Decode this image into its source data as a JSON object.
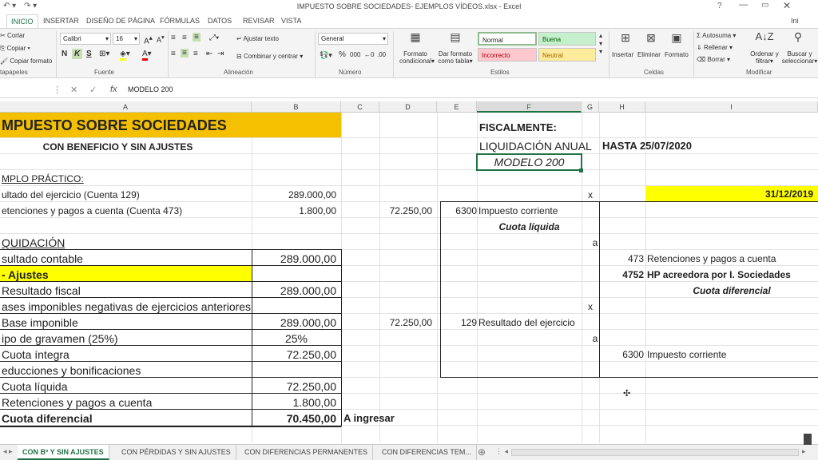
{
  "title": "IMPUESTO SOBRE SOCIEDADES- EJEMPLOS VÍDEOS.xlsx - Excel",
  "signin": "Ini",
  "help": "?",
  "tabs": [
    {
      "label": "INICIO",
      "active": true
    },
    {
      "label": "INSERTAR"
    },
    {
      "label": "DISEÑO DE PÁGINA"
    },
    {
      "label": "FÓRMULAS"
    },
    {
      "label": "DATOS"
    },
    {
      "label": "REVISAR"
    },
    {
      "label": "VISTA"
    }
  ],
  "ribbon": {
    "clipboard": {
      "cut": "Cortar",
      "copy": "Copiar",
      "copy_format": "Copiar formato",
      "label": "tapapeles"
    },
    "font": {
      "name": "Calibri",
      "size": "16",
      "bold": "N",
      "italic": "K",
      "underline": "S",
      "label": "Fuente"
    },
    "alignment": {
      "wrap": "Ajustar texto",
      "merge": "Combinar y centrar",
      "label": "Alineación"
    },
    "number": {
      "format": "General",
      "percent": "%",
      "thousands": "000",
      "label": "Número"
    },
    "styles": {
      "cond_format_1": "Formato",
      "cond_format_2": "condicional",
      "table_format_1": "Dar formato",
      "table_format_2": "como tabla",
      "normal": "Normal",
      "good": "Buena",
      "bad": "Incorrecto",
      "neutral": "Neutral",
      "label": "Estilos"
    },
    "cells": {
      "insert": "Insertar",
      "delete": "Eliminar",
      "format": "Formato",
      "label": "Celdas"
    },
    "editing": {
      "autosum": "Autosuma",
      "fill": "Rellenar",
      "clear": "Borrar",
      "sort_1": "Ordenar y",
      "sort_2": "filtrar",
      "find_1": "Buscar y",
      "find_2": "seleccionar",
      "label": "Modificar"
    }
  },
  "formula_bar": {
    "fx": "fx",
    "value": "MODELO 200"
  },
  "columns": [
    "A",
    "B",
    "C",
    "D",
    "E",
    "F",
    "G",
    "H",
    "I"
  ],
  "cells": {
    "a_title": "MPUESTO SOBRE SOCIEDADES",
    "a_sub": "CON BENEFICIO Y SIN AJUSTES",
    "a_ejemplo": "MPLO PRÁCTICO:",
    "a_r5": "ultado del ejercicio (Cuenta 129)",
    "b_r5": "289.000,00",
    "a_r6": "etenciones y pagos a cuenta (Cuenta 473)",
    "b_r6": "1.800,00",
    "d_r6": "72.250,00",
    "a_liq": "QUIDACIÓN",
    "a_r9": "sultado contable",
    "b_r9": "289.000,00",
    "a_r10": "- Ajustes",
    "a_r11": "Resultado fiscal",
    "b_r11": "289.000,00",
    "a_r12": "ases imponibles negativas de ejercicios anteriores",
    "a_r13": "Base imponible",
    "b_r13": "289.000,00",
    "d_r13": "72.250,00",
    "a_r14": "ipo de gravamen (25%)",
    "b_r14": "25%",
    "a_r15": "Cuota íntegra",
    "b_r15": "72.250,00",
    "a_r16": "educciones y bonificaciones",
    "a_r17": "Cuota líquida",
    "b_r17": "72.250,00",
    "a_r18": "Retenciones y pagos a cuenta",
    "b_r18": "1.800,00",
    "a_r19": "Cuota diferencial",
    "b_r19": "70.450,00",
    "c_r19": "A ingresar",
    "f_fisc": "FISCALMENTE:",
    "f_liq": "LIQUIDACIÓN ANUAL",
    "h_hasta": "HASTA 25/07/2020",
    "f_modelo": "MODELO 200",
    "g_x1": "x",
    "i_date": "31/12/2019",
    "e_6300": "6300",
    "f_imp": "Impuesto corriente",
    "f_cuota": "Cuota líquida",
    "g_a1": "a",
    "h_473": "473",
    "i_ret": "Retenciones y pagos a cuenta",
    "h_4752": "4752",
    "i_hp": "HP acreedora por I. Sociedades",
    "i_cdif": "Cuota diferencial",
    "g_x2": "x",
    "e_129": "129",
    "f_res": "Resultado del ejercicio",
    "g_a2": "a",
    "h_6300": "6300",
    "i_imp": "Impuesto corriente"
  },
  "sheets": [
    "CON Bº Y SIN AJUSTES",
    "CON PÉRDIDAS Y SIN AJUSTES",
    "CON DIFERENCIAS PERMANENTES",
    "CON DIFERENCIAS TEM..."
  ],
  "colors": {
    "orange": "#f5c000",
    "yellow": "#ffff00",
    "excel_green": "#217346"
  }
}
